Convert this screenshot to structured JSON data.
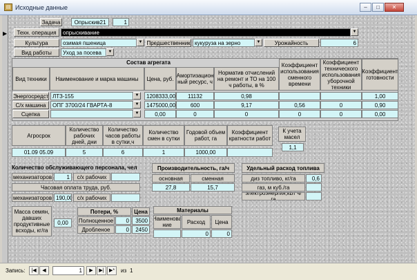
{
  "window": {
    "title": "Исходные данные",
    "icon": "access-form-icon",
    "min": "–",
    "max": "□",
    "close": "✕"
  },
  "task": {
    "label": "Задача",
    "value": "Опрыскив21",
    "number": "1"
  },
  "operation": {
    "label": "Техн. операция",
    "value": "опрыскивание"
  },
  "crop": {
    "label": "Культура",
    "value": "озимая пшеница",
    "prev_label": "Предшественник",
    "prev_value": "кукуруза на зерно",
    "yield_label": "Урожайность",
    "yield_value": "6"
  },
  "work_type": {
    "label": "Вид работы",
    "value": "Уход за посева"
  },
  "unit": {
    "title": "Состав агрегата",
    "headers": [
      "Вид техники",
      "Наименование и марка машины",
      "Цена, руб.",
      "Амортизацион ный ресурс, ч",
      "Норматив отчислений на ремонт и ТО на 100 ч работы, в %",
      "Коэффициент использования сменного времени",
      "Коэффициент технического использования уборочной техники",
      "Коэффициент готовности"
    ],
    "rows": [
      {
        "kind": "Энергосредст",
        "machine": "ЛТЗ-155",
        "price": "1208333,00",
        "resource": "11132",
        "norm": "0,98",
        "k_shift": "",
        "k_tech": "",
        "k_ready": "1,00"
      },
      {
        "kind": "С/х машина",
        "machine": "ОПГ 3700/24 ГВАРТА-8",
        "price": "1475000,00",
        "resource": "600",
        "norm": "9,17",
        "k_shift": "0,56",
        "k_tech": "0",
        "k_ready": "0,90"
      },
      {
        "kind": "Сцепка",
        "machine": "",
        "price": "0,00",
        "resource": "0",
        "norm": "0",
        "k_shift": "0",
        "k_tech": "0",
        "k_ready": "0,00"
      }
    ]
  },
  "agro": {
    "headers": [
      "Агросрок",
      "Количество рабочих дней, дни",
      "Количество часов работы в сутки,ч",
      "Количество смен в сутки",
      "Годовой объем работ, га",
      "Коэффициент кратности работ"
    ],
    "values": [
      "01.09 05.09",
      "5",
      "6",
      "1",
      "1000,00",
      ""
    ],
    "season_label": "К учета масел",
    "season_value": "1,1"
  },
  "staff": {
    "title": "Количество обслуживающего персонала, чел",
    "mech_label": "механизаторов",
    "mech_value": "1",
    "farm_label": "с/х рабочих",
    "farm_value": "",
    "wage_title": "Часовая оплата труда, руб.",
    "mech_wage_label": "механизаторов",
    "mech_wage_value": "190,00",
    "farm_wage_label": "с/х рабочих",
    "farm_wage_value": ""
  },
  "productivity": {
    "title": "Производительность, га/ч",
    "main_label": "основная",
    "shift_label": "сменная",
    "main_value": "27,8",
    "shift_value": "15,7"
  },
  "consumption": {
    "title": "Удельный расход топлива",
    "diesel_label": "диз топливо, кг/га",
    "diesel_value": "0,6",
    "gas_label": "газ, м куб./га",
    "gas_value": "",
    "power_label": "электроэнергия,кВт ч/га",
    "power_value": ""
  },
  "seed_mass": {
    "label": "Масса семян, давших продуктивные всходы, кг/га",
    "value": "0,00"
  },
  "losses": {
    "title": "Потери, %",
    "price_title": "Цена",
    "full_label": "Полноценное",
    "full_value": "0",
    "full_price": "3500",
    "crushed_label": "Дробленое",
    "crushed_value": "0",
    "crushed_price": "2450"
  },
  "materials": {
    "title": "Материалы",
    "col_name": "Наименова ние",
    "col_rate": "Расход",
    "col_price": "Цена",
    "rate_value": "0",
    "price_value": "0"
  },
  "record_nav": {
    "label": "Запись:",
    "first": "|◀",
    "prev": "◀",
    "current": "1",
    "next": "▶",
    "last": "▶|",
    "new": "▶*",
    "of_label": "из",
    "total": "1"
  }
}
